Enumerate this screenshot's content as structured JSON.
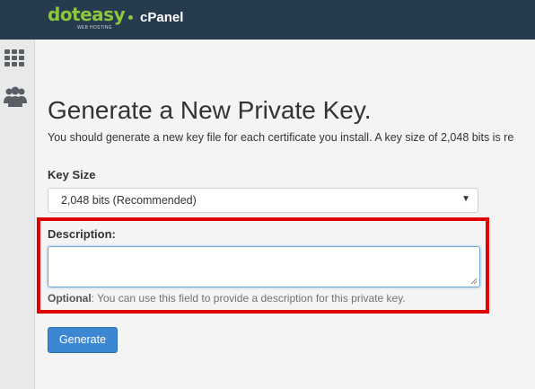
{
  "header": {
    "logo_text": "doteasy",
    "logo_subtext": "WEB HOSTING",
    "product": "cPanel"
  },
  "sidebar": {
    "icons": [
      "apps-grid-icon",
      "users-icon"
    ]
  },
  "main": {
    "title": "Generate a New Private Key.",
    "description": "You should generate a new key file for each certificate you install. A key size of 2,048 bits is re",
    "key_size": {
      "label": "Key Size",
      "selected": "2,048 bits (Recommended)"
    },
    "description_field": {
      "label": "Description:",
      "value": "",
      "help_bold": "Optional",
      "help_text": ": You can use this field to provide a description for this private key."
    },
    "generate_label": "Generate"
  },
  "colors": {
    "topbar": "#273b4e",
    "brand_green": "#8dc63f",
    "primary_button": "#3c87d2",
    "highlight": "#e00000"
  }
}
